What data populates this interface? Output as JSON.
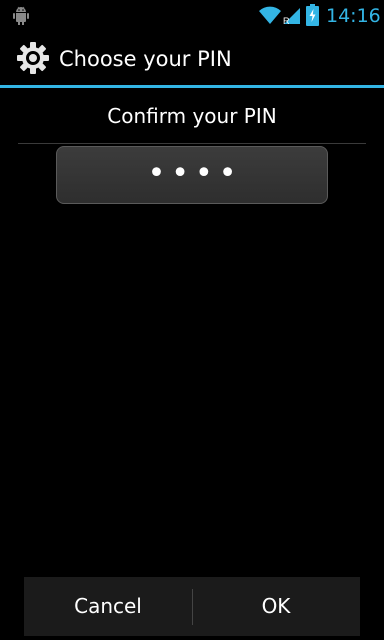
{
  "status_bar": {
    "time": "14:16",
    "icons": [
      "android-debug-icon",
      "wifi-icon",
      "signal-icon",
      "battery-charging-icon"
    ],
    "accent_color": "#33b5e5"
  },
  "action_bar": {
    "title": "Choose your PIN",
    "icon": "gear-icon"
  },
  "content": {
    "prompt": "Confirm your PIN",
    "pin_masked": "••••"
  },
  "buttons": {
    "cancel_label": "Cancel",
    "ok_label": "OK"
  }
}
